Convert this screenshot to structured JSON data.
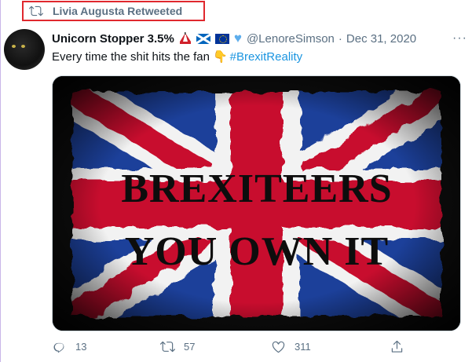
{
  "retweet_banner": {
    "label": "Livia Augusta Retweeted",
    "icon": "retweet-icon"
  },
  "tweet": {
    "display_name": "Unicorn Stopper 3.5%",
    "name_emojis": [
      "circus-tent-emoji",
      "scotland-flag-emoji",
      "eu-flag-emoji",
      "blue-heart-emoji"
    ],
    "handle": "@LenoreSimson",
    "separator": "·",
    "date": "Dec 31, 2020",
    "more_icon": "more-options-icon",
    "text": "Every time the shit hits the fan",
    "text_emoji": "backhand-index-pointing-down-emoji",
    "hashtag": "#BrexitReality",
    "media": {
      "line1": "BREXITEERS",
      "line2": "YOU OWN IT",
      "colors": {
        "red": "#c8102e",
        "blue": "#012169",
        "white": "#f2f2f2",
        "ink": "#0d0d0d"
      }
    },
    "actions": {
      "reply_count": "13",
      "retweet_count": "57",
      "like_count": "311"
    }
  },
  "colors": {
    "highlight_border": "#e0282e",
    "secondary_text": "#5b7083",
    "link": "#1b95e0"
  }
}
